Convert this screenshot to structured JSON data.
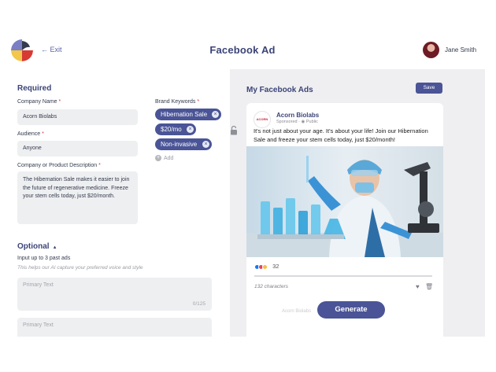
{
  "header": {
    "exit_label": "Exit",
    "title": "Facebook Ad",
    "user_name": "Jane Smith"
  },
  "required": {
    "section_title": "Required",
    "company_name": {
      "label": "Company Name",
      "value": "Acorn Biolabs"
    },
    "audience": {
      "label": "Audience",
      "value": "Anyone"
    },
    "description": {
      "label": "Company or Product Description",
      "value": "The Hibernation Sale makes it easier to join the future of regenerative medicine. Freeze your stem cells today, just $20/month."
    },
    "brand_keywords": {
      "label": "Brand Keywords",
      "tags": [
        "Hibernation Sale",
        "$20/mo",
        "Non-invasive"
      ],
      "add_label": "Add"
    }
  },
  "optional": {
    "section_title": "Optional",
    "subtitle": "Input up to 3 past ads",
    "hint": "This helps our AI capture your preferred voice and style",
    "past_ads": [
      {
        "placeholder": "Primary Text",
        "count": "0/125"
      },
      {
        "placeholder": "Primary Text"
      }
    ]
  },
  "preview": {
    "title": "My Facebook Ads",
    "save_label": "Save",
    "ad": {
      "brand_logo_text": "ACORN",
      "brand": "Acorn Biolabs",
      "sponsored": "Sponsored",
      "visibility": "Public",
      "text": "It's not just about your age. It's about your life! Join our Hibernation Sale and freeze your stem cells today, just $20/month!",
      "reaction_count": "32",
      "characters": "132 characters"
    },
    "next_card_brand": "Acorn Biolabs",
    "generate_label": "Generate"
  },
  "colors": {
    "accent": "#4a5496",
    "title": "#3c4478",
    "required_mark": "#d13a3a",
    "field_bg": "#eeeff1",
    "panel_bg": "#efeff1"
  },
  "icons": {
    "exit": "arrow-left-icon",
    "tag_remove": "close-icon",
    "add": "plus-icon",
    "collapse": "caret-up-icon",
    "like": "heart-icon",
    "delete": "trash-icon",
    "lock": "unlock-icon"
  }
}
